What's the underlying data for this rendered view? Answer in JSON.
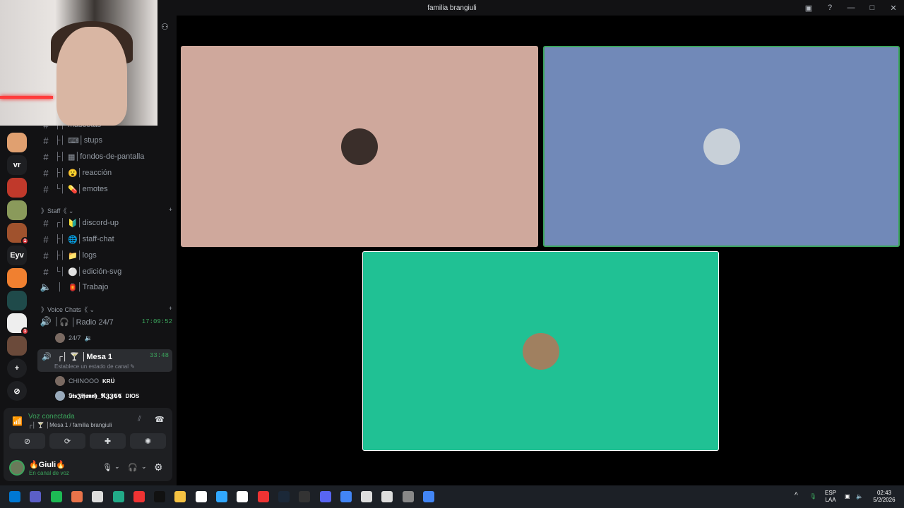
{
  "window": {
    "title": "familia brangiuli",
    "controls": [
      "inbox-icon",
      "help-icon",
      "minimize-icon",
      "maximize-icon",
      "close-icon"
    ]
  },
  "guilds": [
    {
      "label": "",
      "color": "#e0a070"
    },
    {
      "label": "vr",
      "color": "#1e1f22"
    },
    {
      "label": "",
      "color": "#c0392b"
    },
    {
      "label": "",
      "color": "#8a9a5b"
    },
    {
      "label": "",
      "color": "#a0522d",
      "badge": "1"
    },
    {
      "label": "Eyv",
      "color": "#1e1f22"
    },
    {
      "label": "",
      "color": "#f08030"
    },
    {
      "label": "",
      "color": "#1f4a4a"
    },
    {
      "label": "",
      "color": "#eeeeee",
      "badge": "1"
    },
    {
      "label": "",
      "color": "#6b4a3a"
    },
    {
      "label": "+",
      "color": "#1e1f22"
    },
    {
      "label": "⊘",
      "color": "#1e1f22"
    }
  ],
  "channels": {
    "partial": "mascotas",
    "items": [
      {
        "tree": "├│",
        "emoji": "⌨",
        "name": "stups"
      },
      {
        "tree": "├│",
        "emoji": "▦",
        "name": "fondos-de-pantalla"
      },
      {
        "tree": "├│",
        "emoji": "😮",
        "name": "reacción"
      },
      {
        "tree": "└│",
        "emoji": "💊",
        "name": "emotes"
      }
    ],
    "staff_category": "》Staff《 ⌄",
    "staff": [
      {
        "tree": "┌│",
        "emoji": "🔰",
        "name": "discord-up"
      },
      {
        "tree": "├│",
        "emoji": "🌐",
        "name": "staff-chat"
      },
      {
        "tree": "├│",
        "emoji": "📁",
        "name": "logs"
      },
      {
        "tree": "└│",
        "emoji": "⚪",
        "name": "edición-svg"
      }
    ],
    "trabajo": {
      "emoji": "🏮",
      "name": "Trabajo"
    },
    "voice_category": "》Voice Chats《 ⌄",
    "radio": {
      "name": "🎧 │Radio 24/7",
      "time": "17:09:52",
      "user": "24/7"
    },
    "mesa": {
      "name": "┌│ 🍸 │Mesa 1",
      "time": "33:48",
      "status": "Establece un estado de canal ✎"
    },
    "users": [
      {
        "name": "CHINOOO",
        "tag": "KRÜ"
      },
      {
        "name": "𝕴𝖙𝖘𝕵𝖎𝖋𝖆𝖓𝖊𝖍_𝕽𝖅𝖅𝕮𝕮",
        "tag": "DIOS"
      }
    ]
  },
  "voice": {
    "status": "Voz conectada",
    "location": "┌│ 🍸 │Mesa 1 / familia brangiuli"
  },
  "user": {
    "name": "🔥Giuli🔥",
    "status": "En canal de voz"
  },
  "tiles": [
    {
      "color": "#cfa89c"
    },
    {
      "color": "#7189b8",
      "speaking": true
    },
    {
      "color": "#20c194"
    }
  ],
  "taskbar": {
    "lang": "ESP",
    "layout": "LAA",
    "time": "02:43",
    "date": "5/2/2026"
  }
}
